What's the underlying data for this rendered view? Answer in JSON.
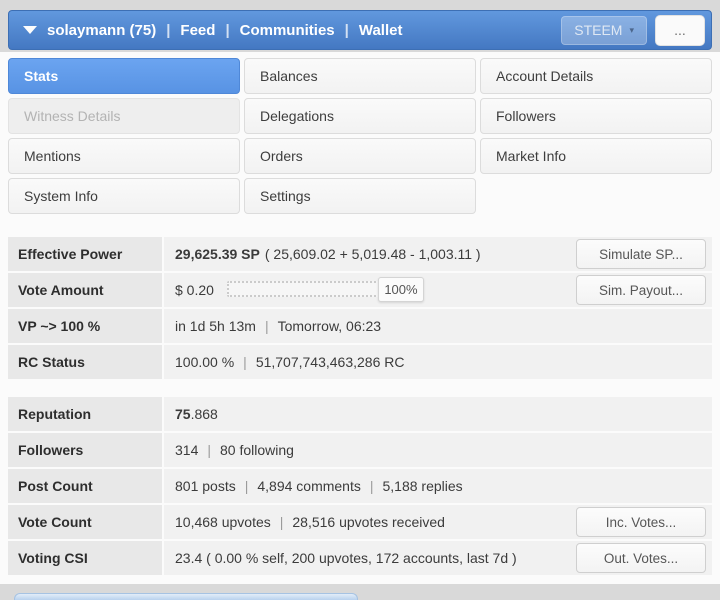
{
  "colors": {
    "header_blue_top": "#6198de",
    "header_blue_bottom": "#4478c2",
    "active_tab_blue": "#5f9ceb",
    "label_cell_bg": "#e8e8e8",
    "value_cell_bg": "#f1f1f1",
    "next_section_blue": "#b9d2ee"
  },
  "sep": "|",
  "header": {
    "account_label": "solaymann (75)",
    "nav": [
      {
        "label": "Feed"
      },
      {
        "label": "Communities"
      },
      {
        "label": "Wallet"
      }
    ],
    "currency": {
      "label": "STEEM",
      "caret": "▾"
    },
    "more_label": "..."
  },
  "tabs": [
    {
      "label": "Stats",
      "state": "active"
    },
    {
      "label": "Balances",
      "state": "normal"
    },
    {
      "label": "Account Details",
      "state": "normal"
    },
    {
      "label": "Witness Details",
      "state": "disabled"
    },
    {
      "label": "Delegations",
      "state": "normal"
    },
    {
      "label": "Followers",
      "state": "normal"
    },
    {
      "label": "Mentions",
      "state": "normal"
    },
    {
      "label": "Orders",
      "state": "normal"
    },
    {
      "label": "Market Info",
      "state": "normal"
    },
    {
      "label": "System Info",
      "state": "normal"
    },
    {
      "label": "Settings",
      "state": "normal"
    }
  ],
  "stats": {
    "effective_power": {
      "label": "Effective Power",
      "value_bold": "29,625.39 SP",
      "value_rest": "( 25,609.02 + 5,019.48 - 1,003.11 )",
      "button": "Simulate SP..."
    },
    "vote_amount": {
      "label": "Vote Amount",
      "amount": "$ 0.20",
      "slider_percent": "100%",
      "button": "Sim. Payout..."
    },
    "vp": {
      "label": "VP ~> 100 %",
      "time_remaining": "in 1d 5h 13m",
      "eta": "Tomorrow, 06:23"
    },
    "rc": {
      "label": "RC Status",
      "percent": "100.00 %",
      "rc_value": "51,707,743,463,286 RC"
    },
    "reputation": {
      "label": "Reputation",
      "value_bold": "75",
      "value_rest": ".868"
    },
    "followers": {
      "label": "Followers",
      "count": "314",
      "following": "80 following"
    },
    "post_count": {
      "label": "Post Count",
      "posts": "801 posts",
      "comments": "4,894 comments",
      "replies": "5,188 replies"
    },
    "vote_count": {
      "label": "Vote Count",
      "upvotes": "10,468 upvotes",
      "received": "28,516 upvotes received",
      "button": "Inc. Votes..."
    },
    "voting_csi": {
      "label": "Voting CSI",
      "value": "23.4 ( 0.00 % self, 200 upvotes, 172 accounts, last 7d )",
      "button": "Out. Votes..."
    }
  }
}
